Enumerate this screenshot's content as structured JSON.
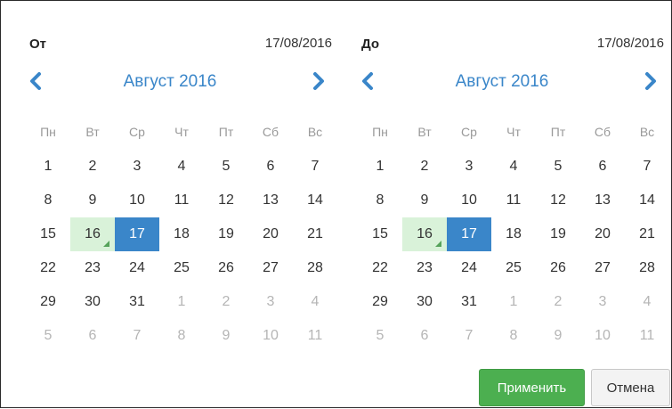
{
  "colors": {
    "accent": "#3a86c9",
    "today_bg": "#d9f2d9",
    "today_marker": "#56a35b",
    "apply_bg": "#4caf50",
    "muted_day": "#b5b5b5"
  },
  "weekdays": [
    "Пн",
    "Вт",
    "Ср",
    "Чт",
    "Пт",
    "Сб",
    "Вс"
  ],
  "left": {
    "label": "От",
    "value": "17/08/2016",
    "month_title": "Август 2016",
    "prev_icon": "chevron-left-icon",
    "next_icon": "chevron-right-icon",
    "weeks": [
      [
        "1",
        "2",
        "3",
        "4",
        "5",
        "6",
        "7"
      ],
      [
        "8",
        "9",
        "10",
        "11",
        "12",
        "13",
        "14"
      ],
      [
        "15",
        "16",
        "17",
        "18",
        "19",
        "20",
        "21"
      ],
      [
        "22",
        "23",
        "24",
        "25",
        "26",
        "27",
        "28"
      ],
      [
        "29",
        "30",
        "31",
        "1",
        "2",
        "3",
        "4"
      ],
      [
        "5",
        "6",
        "7",
        "8",
        "9",
        "10",
        "11"
      ]
    ],
    "today": "16",
    "selected": "17"
  },
  "right": {
    "label": "До",
    "value": "17/08/2016",
    "month_title": "Август 2016",
    "prev_icon": "chevron-left-icon",
    "next_icon": "chevron-right-icon",
    "weeks": [
      [
        "1",
        "2",
        "3",
        "4",
        "5",
        "6",
        "7"
      ],
      [
        "8",
        "9",
        "10",
        "11",
        "12",
        "13",
        "14"
      ],
      [
        "15",
        "16",
        "17",
        "18",
        "19",
        "20",
        "21"
      ],
      [
        "22",
        "23",
        "24",
        "25",
        "26",
        "27",
        "28"
      ],
      [
        "29",
        "30",
        "31",
        "1",
        "2",
        "3",
        "4"
      ],
      [
        "5",
        "6",
        "7",
        "8",
        "9",
        "10",
        "11"
      ]
    ],
    "today": "16",
    "selected": "17"
  },
  "buttons": {
    "apply_label": "Применить",
    "cancel_label": "Отмена"
  }
}
